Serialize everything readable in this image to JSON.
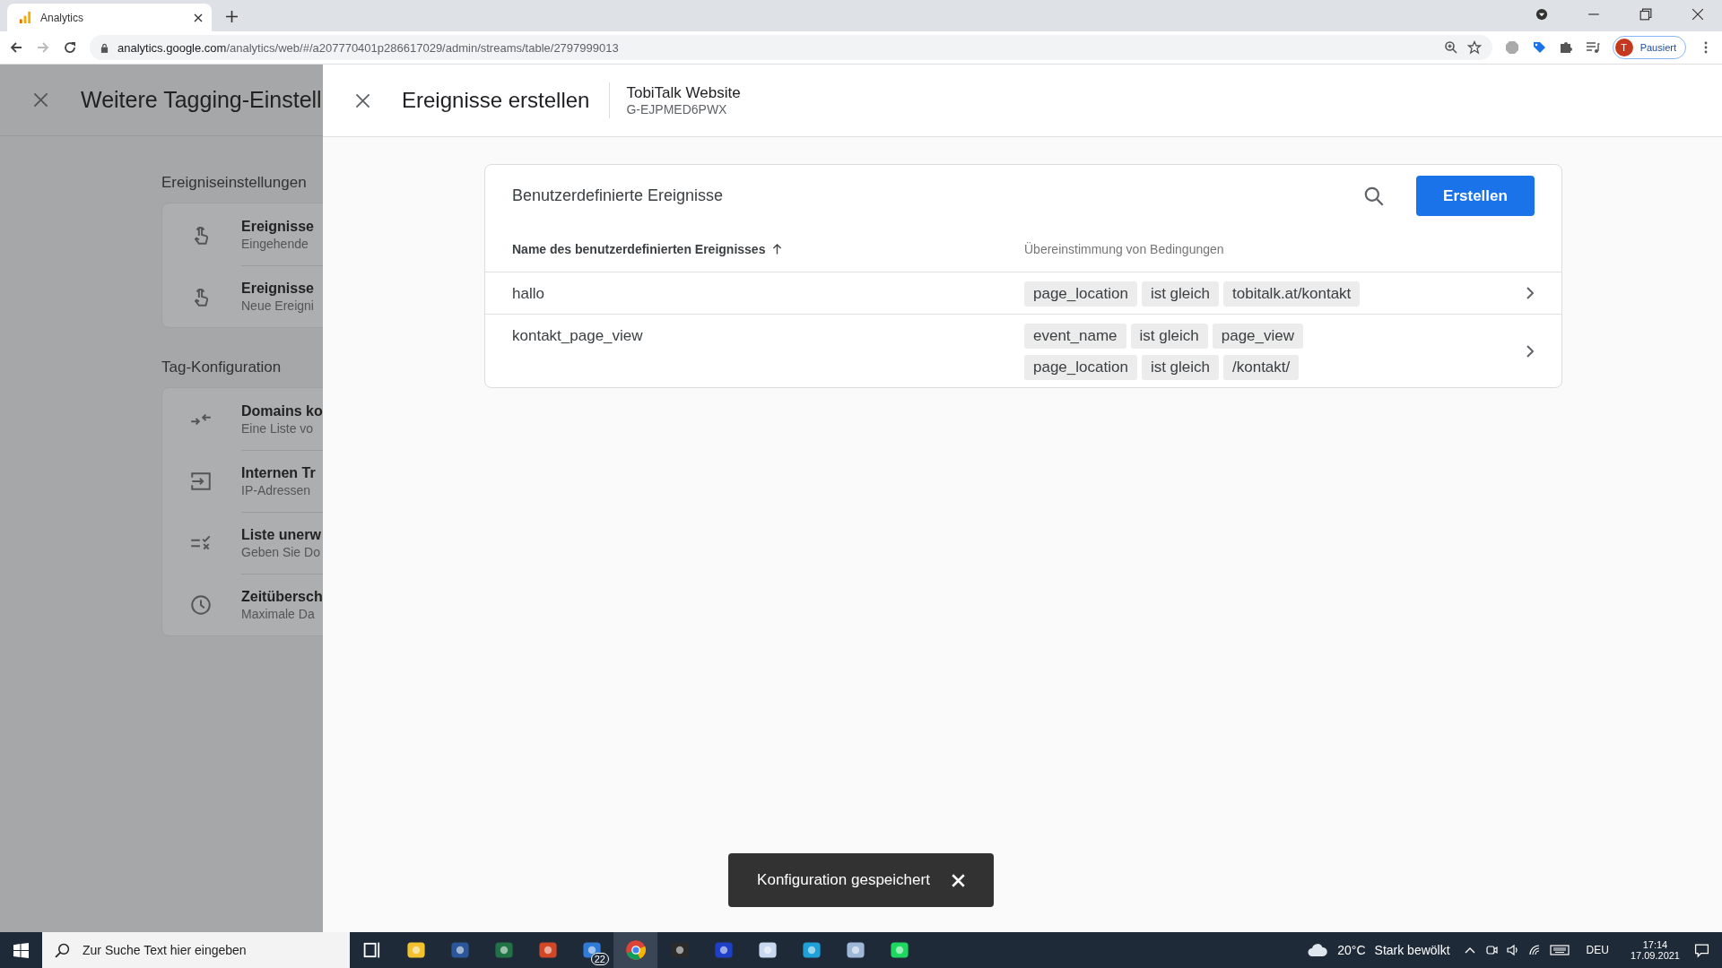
{
  "browser": {
    "tab_title": "Analytics",
    "url_domain": "analytics.google.com",
    "url_path": "/analytics/web/#/a207770401p286617029/admin/streams/table/2797999013",
    "profile_initial": "T",
    "profile_label": "Pausiert"
  },
  "left_panel": {
    "title": "Weitere Tagging-Einstell",
    "sections": [
      {
        "title": "Ereigniseinstellungen",
        "items": [
          {
            "kind": "touch",
            "title": "Ereignisse",
            "subtitle": "Eingehende"
          },
          {
            "kind": "touch",
            "title": "Ereignisse",
            "subtitle": "Neue Ereigni"
          }
        ]
      },
      {
        "title": "Tag-Konfiguration",
        "items": [
          {
            "kind": "merge",
            "title": "Domains ko",
            "subtitle": "Eine Liste vo"
          },
          {
            "kind": "enter",
            "title": "Internen Tr",
            "subtitle": "IP-Adressen"
          },
          {
            "kind": "listcheck",
            "title": "Liste unerw",
            "subtitle": "Geben Sie Do"
          },
          {
            "kind": "clock",
            "title": "Zeitübersch",
            "subtitle": "Maximale Da"
          }
        ]
      }
    ]
  },
  "sheet": {
    "title": "Ereignisse erstellen",
    "property_name": "TobiTalk Website",
    "property_id": "G-EJPMED6PWX"
  },
  "card": {
    "title": "Benutzerdefinierte Ereignisse",
    "create_button": "Erstellen",
    "columns": [
      {
        "label": "Name des benutzerdefinierten Ereignisses",
        "sorted": true
      },
      {
        "label": "Übereinstimmung von Bedingungen",
        "sorted": false
      }
    ],
    "rows": [
      {
        "name": "hallo",
        "conditions": [
          [
            "page_location",
            "ist gleich",
            "tobitalk.at/kontakt"
          ]
        ]
      },
      {
        "name": "kontakt_page_view",
        "conditions": [
          [
            "event_name",
            "ist gleich",
            "page_view"
          ],
          [
            "page_location",
            "ist gleich",
            "/kontakt/"
          ]
        ]
      }
    ]
  },
  "snackbar": {
    "text": "Konfiguration gespeichert"
  },
  "taskbar": {
    "search_placeholder": "Zur Suche Text hier eingeben",
    "apps": [
      {
        "kind": "taskview",
        "selected": false
      },
      {
        "kind": "files",
        "selected": false
      },
      {
        "kind": "word",
        "selected": false
      },
      {
        "kind": "excel",
        "selected": false
      },
      {
        "kind": "powerpoint",
        "selected": false
      },
      {
        "kind": "mail",
        "selected": false,
        "badge": "22"
      },
      {
        "kind": "chrome",
        "selected": true
      },
      {
        "kind": "obs",
        "selected": false
      },
      {
        "kind": "headset",
        "selected": false
      },
      {
        "kind": "paint",
        "selected": false
      },
      {
        "kind": "edge",
        "selected": false
      },
      {
        "kind": "notepad",
        "selected": false
      },
      {
        "kind": "spotify",
        "selected": false
      }
    ],
    "temperature": "20°C",
    "weather": "Stark bewölkt",
    "language": "DEU",
    "time": "17:14",
    "date": "17.09.2021"
  }
}
